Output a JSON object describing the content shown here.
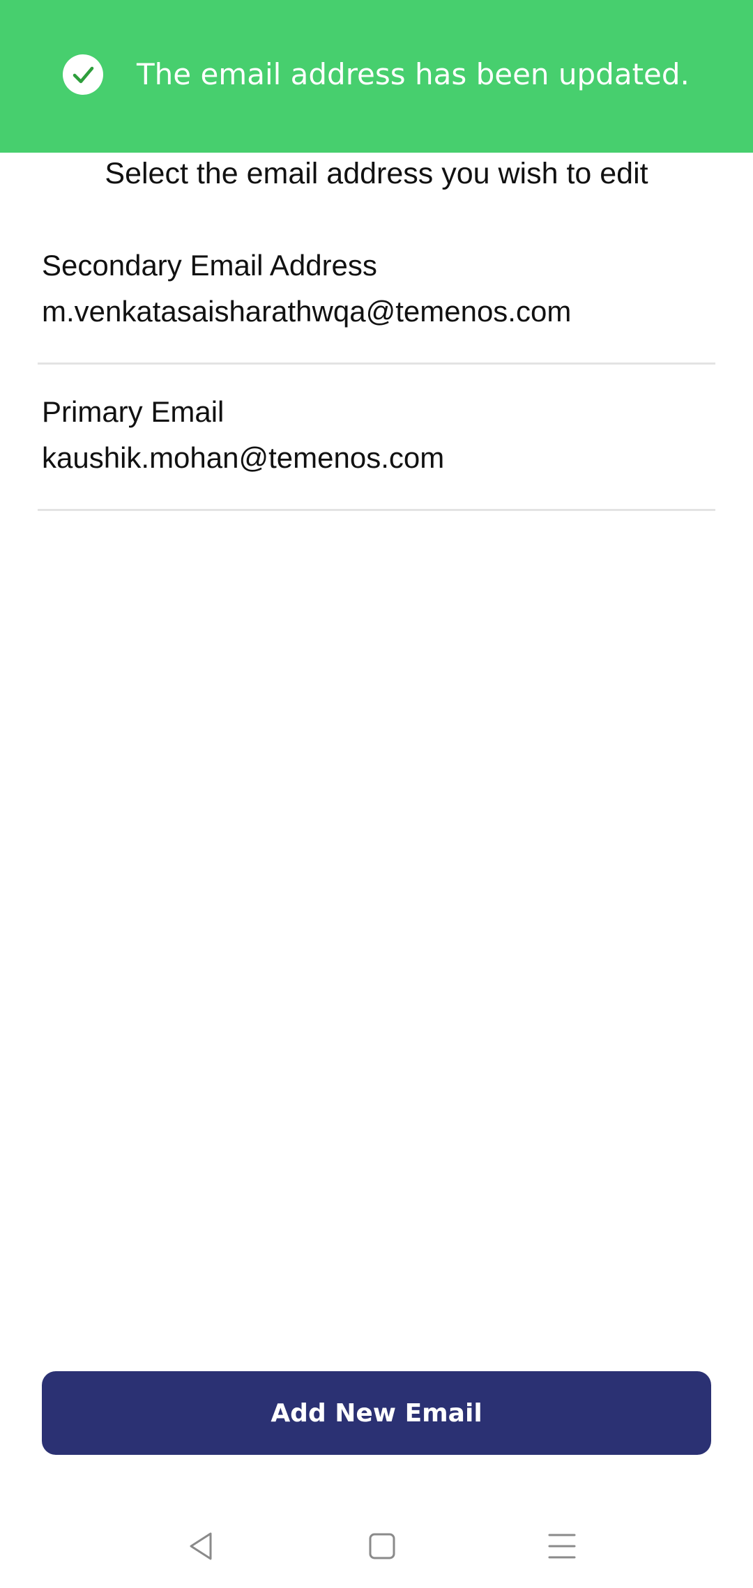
{
  "toast": {
    "icon": "checkmark-circle-icon",
    "message": "The email address has been updated.",
    "background_color": "#47cf6e",
    "check_color": "#2e9e3c"
  },
  "instruction": "Select the email address you wish to edit",
  "emails": [
    {
      "label": "Secondary Email Address",
      "address": "m.venkatasaisharathwqa@temenos.com"
    },
    {
      "label": "Primary Email",
      "address": "kaushik.mohan@temenos.com"
    }
  ],
  "add_button": {
    "label": "Add New Email",
    "color": "#2b3173"
  },
  "nav_bar": {
    "icons": [
      "back-triangle-icon",
      "home-square-icon",
      "menu-lines-icon"
    ]
  }
}
